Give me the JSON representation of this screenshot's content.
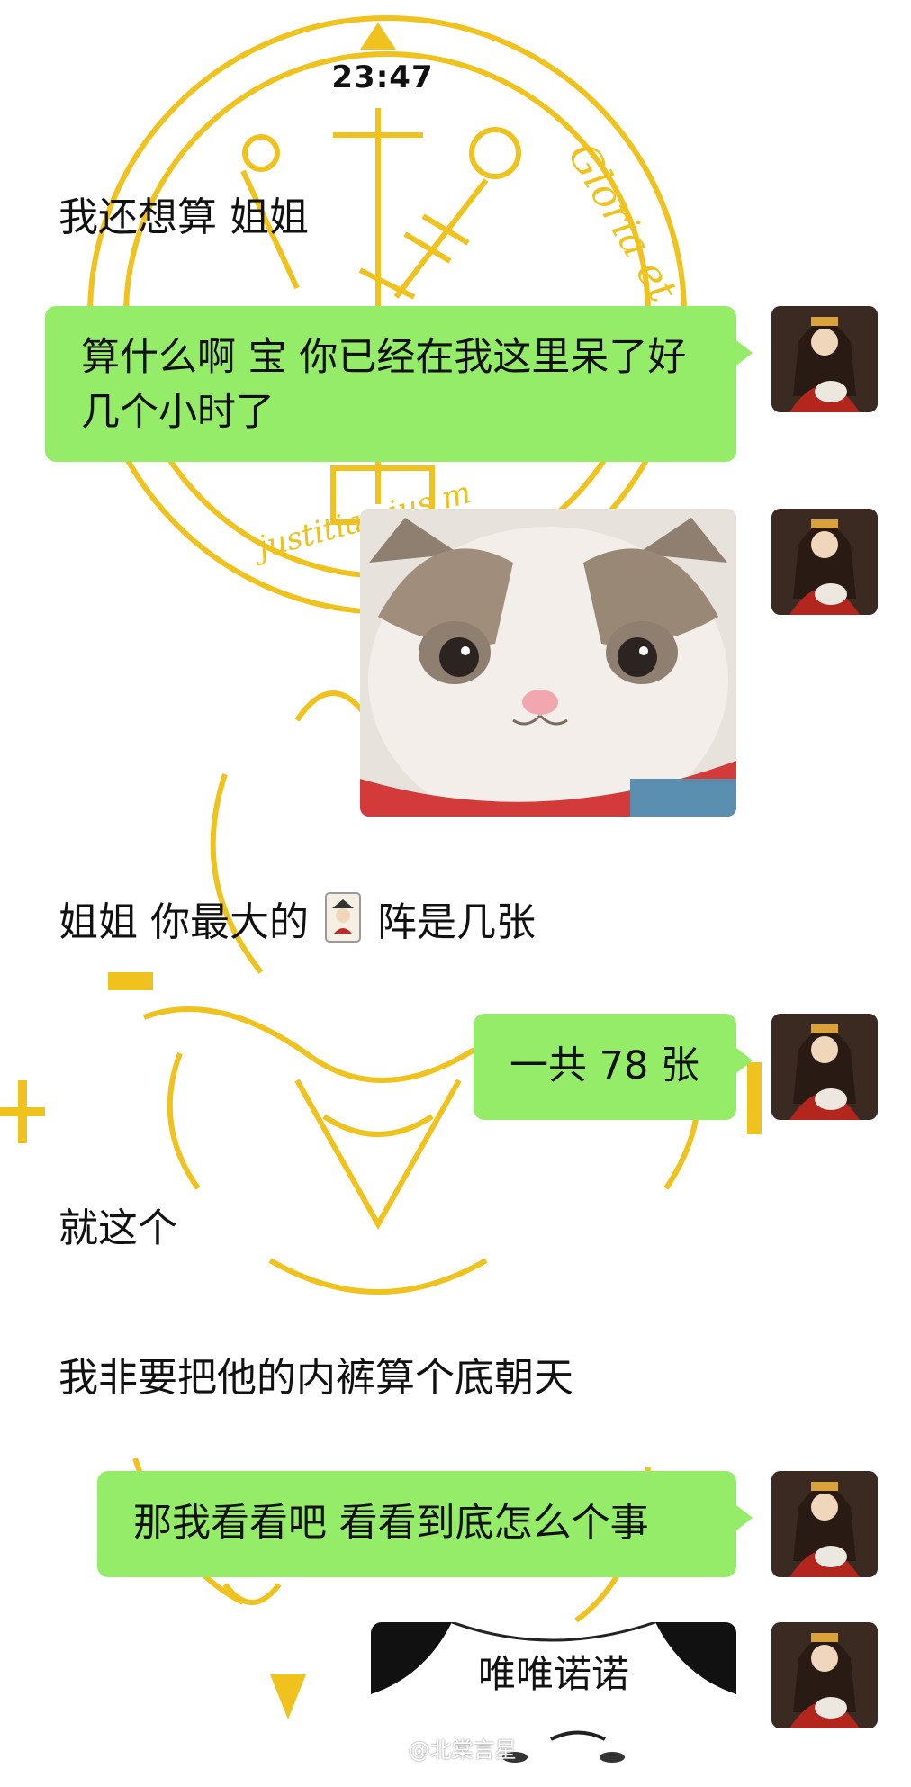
{
  "status_bar": {
    "time": "23:47"
  },
  "background": {
    "circle_motto_1": "Gloria et d",
    "circle_motto_2": "justitia eius m",
    "accent_color": "#f0c21e"
  },
  "messages": [
    {
      "side": "left",
      "text": "我还想算 姐姐"
    },
    {
      "side": "right",
      "text": "算什么啊 宝 你已经在我这里呆了好几个小时了"
    },
    {
      "side": "right",
      "type": "sticker",
      "sticker": "cat-face-sticker"
    },
    {
      "side": "left",
      "text_before": "姐姐 你最大的",
      "emoji": "joker-card-icon",
      "text_after": "阵是几张"
    },
    {
      "side": "right",
      "text": "一共 78 张"
    },
    {
      "side": "left",
      "text": "就这个"
    },
    {
      "side": "left",
      "text": "我非要把他的内裤算个底朝天"
    },
    {
      "side": "right",
      "text": "那我看看吧 看看到底怎么个事"
    },
    {
      "side": "right",
      "type": "sticker",
      "sticker": "panda-meme-sticker",
      "caption": "唯唯诺诺"
    }
  ],
  "watermark": {
    "text": "@北棠言星"
  },
  "colors": {
    "bubble_green": "#95ec69",
    "text": "#111111"
  }
}
